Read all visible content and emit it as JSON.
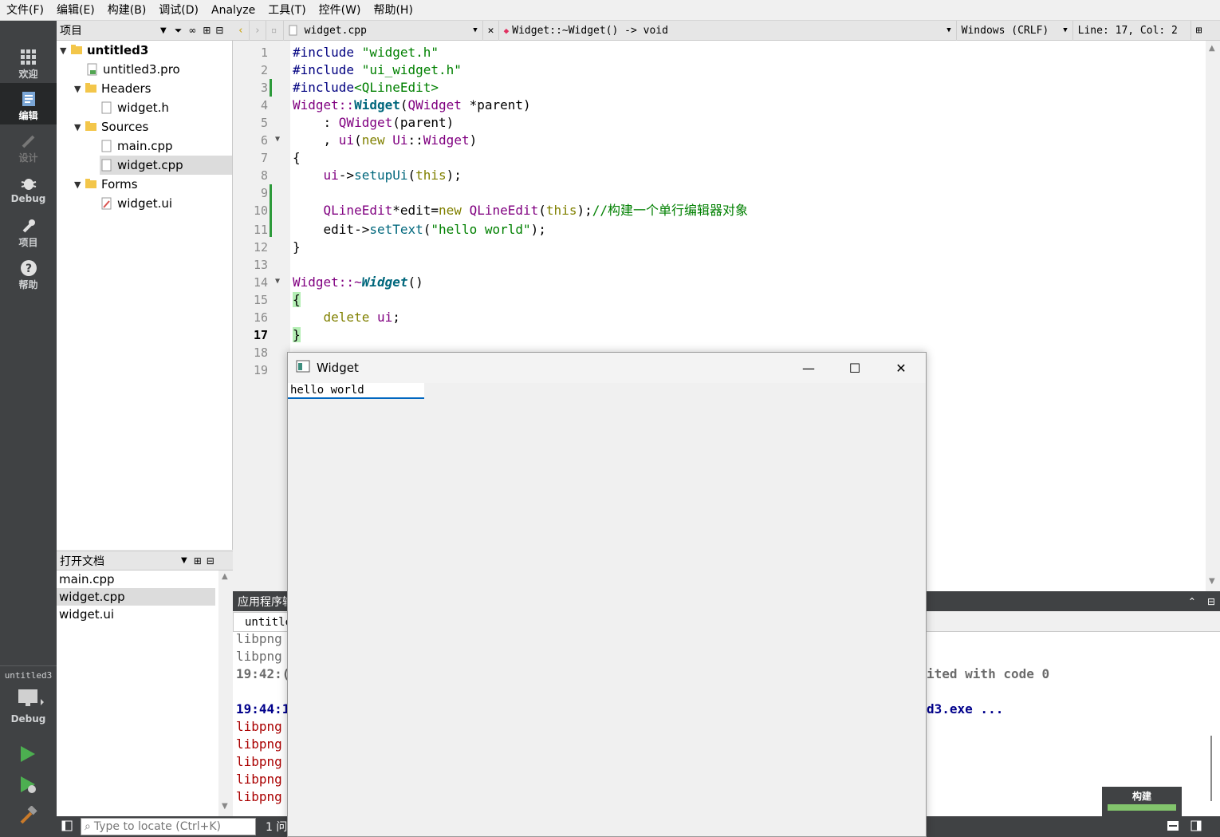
{
  "menu": [
    "文件(F)",
    "编辑(E)",
    "构建(B)",
    "调试(D)",
    "Analyze",
    "工具(T)",
    "控件(W)",
    "帮助(H)"
  ],
  "modes": {
    "welcome": "欢迎",
    "edit": "编辑",
    "design": "设计",
    "debug": "Debug",
    "projects": "项目",
    "help": "帮助"
  },
  "kit": {
    "project": "untitled3",
    "mode": "Debug"
  },
  "project_panel": {
    "title": "项目",
    "root": "untitled3",
    "pro_file": "untitled3.pro",
    "headers": "Headers",
    "header_file": "widget.h",
    "sources": "Sources",
    "source_files": [
      "main.cpp",
      "widget.cpp"
    ],
    "forms": "Forms",
    "form_file": "widget.ui"
  },
  "open_docs": {
    "title": "打开文档",
    "items": [
      "main.cpp",
      "widget.cpp",
      "widget.ui"
    ]
  },
  "editor": {
    "file": "widget.cpp",
    "symbol": "Widget::~Widget() -> void",
    "encoding": "Windows (CRLF)",
    "position": "Line: 17, Col: 2",
    "line_numbers": [
      "1",
      "2",
      "3",
      "4",
      "5",
      "6",
      "7",
      "8",
      "9",
      "10",
      "11",
      "12",
      "13",
      "14",
      "15",
      "16",
      "17",
      "18",
      "19"
    ],
    "code": {
      "l1a": "#include ",
      "l1b": "\"widget.h\"",
      "l2a": "#include ",
      "l2b": "\"ui_widget.h\"",
      "l3a": "#include",
      "l3b": "<QLineEdit>",
      "l4a": "Widget::",
      "l4b": "Widget",
      "l4c": "(",
      "l4d": "QWidget",
      "l4e": " *parent)",
      "l5a": "    : ",
      "l5b": "QWidget",
      "l5c": "(parent)",
      "l6a": "    , ",
      "l6b": "ui",
      "l6c": "(",
      "l6d": "new",
      "l6e": " ",
      "l6f": "Ui",
      "l6g": "::",
      "l6h": "Widget",
      "l6i": ")",
      "l7": "{",
      "l8a": "    ",
      "l8b": "ui",
      "l8c": "->",
      "l8d": "setupUi",
      "l8e": "(",
      "l8f": "this",
      "l8g": ");",
      "l10a": "    ",
      "l10b": "QLineEdit",
      "l10c": "*edit=",
      "l10d": "new",
      "l10e": " ",
      "l10f": "QLineEdit",
      "l10g": "(",
      "l10h": "this",
      "l10i": ");",
      "l10j": "//构建一个单行编辑器对象",
      "l11a": "    edit->",
      "l11b": "setText",
      "l11c": "(",
      "l11d": "\"hello world\"",
      "l11e": ");",
      "l12": "}",
      "l14a": "Widget::~",
      "l14b": "Widget",
      "l14c": "()",
      "l15": "{",
      "l16a": "    ",
      "l16b": "delete",
      "l16c": " ",
      "l16d": "ui",
      "l16e": ";",
      "l17": "}"
    }
  },
  "output": {
    "title": "应用程序输",
    "tab": "untitle",
    "lines_left": [
      "libpng",
      "libpng",
      "19:42:(",
      "19:44:1",
      "libpng",
      "libpng",
      "libpng",
      "libpng",
      "libpng"
    ],
    "right1": "ited with code 0",
    "right2": "d3.exe ..."
  },
  "build": {
    "label": "构建",
    "progress": 1.0
  },
  "status": {
    "locator_placeholder": "Type to locate (Ctrl+K)",
    "issues": "1 问"
  },
  "widget_window": {
    "title": "Widget",
    "lineedit_value": "hello world"
  }
}
